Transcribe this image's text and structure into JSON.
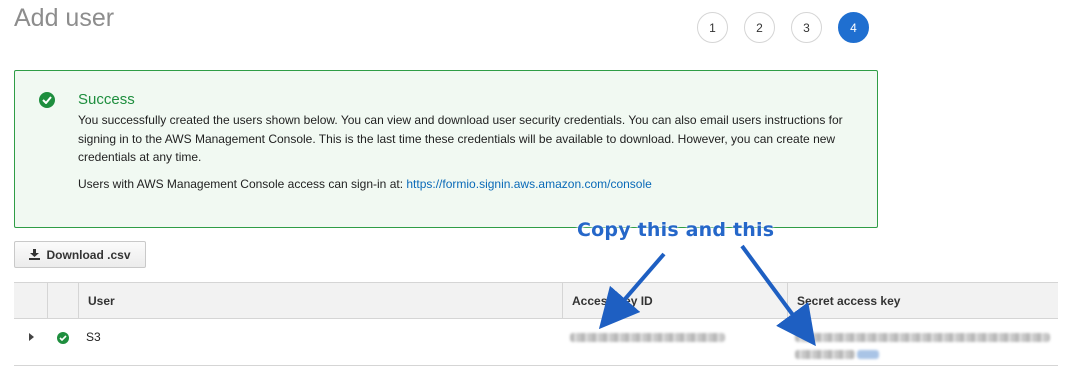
{
  "page": {
    "title": "Add user"
  },
  "steps": [
    "1",
    "2",
    "3",
    "4"
  ],
  "active_step": "4",
  "success": {
    "icon": "check-circle-icon",
    "title": "Success",
    "message": "You successfully created the users shown below. You can view and download user security credentials. You can also email users instructions for signing in to the AWS Management Console. This is the last time these credentials will be available to download. However, you can create new credentials at any time.",
    "signin_prefix": "Users with AWS Management Console access can sign-in at:",
    "signin_url": "https://formio.signin.aws.amazon.com/console"
  },
  "toolbar": {
    "download_label": "Download .csv",
    "download_icon": "download-icon"
  },
  "annotation": {
    "text": "Copy this and this"
  },
  "table": {
    "headers": [
      "User",
      "Access key ID",
      "Secret access key"
    ],
    "rows": [
      {
        "user": "S3",
        "status_icon": "check-circle-icon"
      }
    ]
  },
  "colors": {
    "success": "#1e8e3e",
    "active_step": "#1f6fd0",
    "link": "#0a6ab8",
    "annotation": "#2567c9"
  }
}
